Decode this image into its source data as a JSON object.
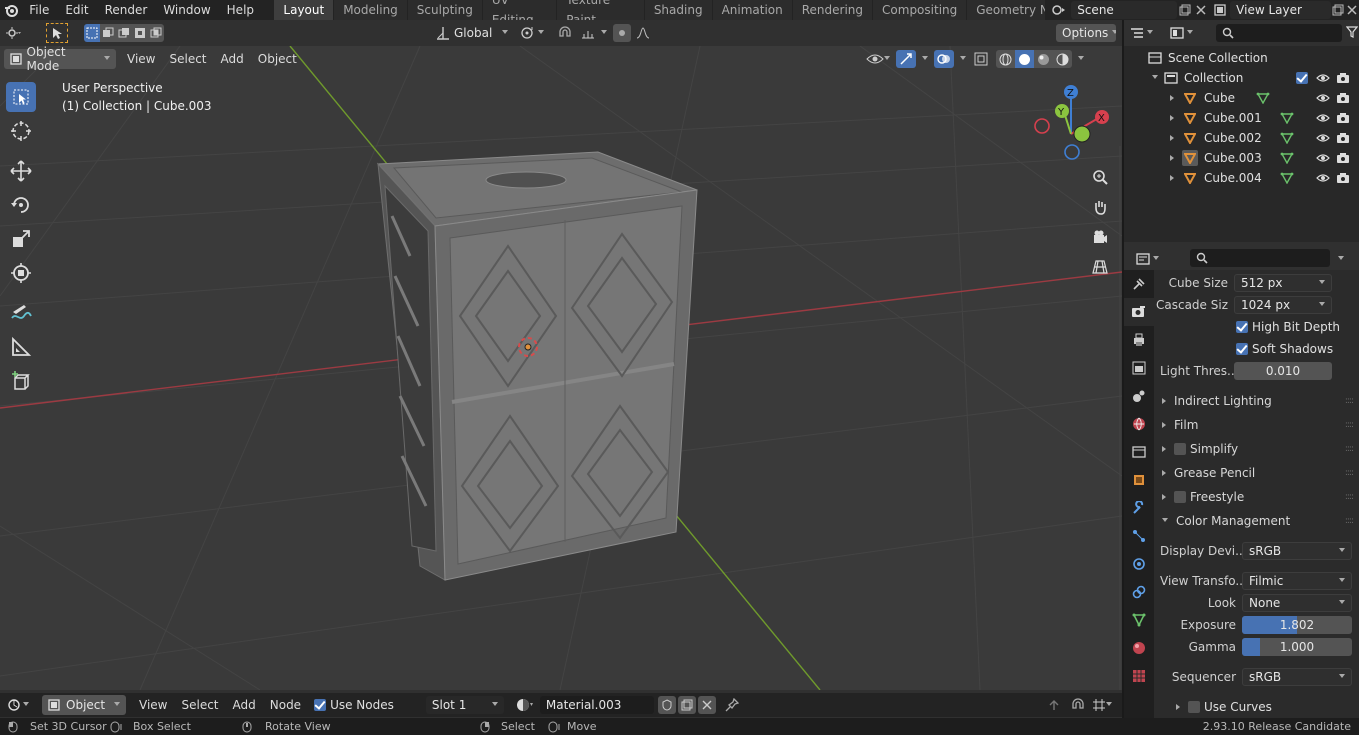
{
  "topbar": {
    "menus": [
      "File",
      "Edit",
      "Render",
      "Window",
      "Help"
    ],
    "workspaces": [
      "Layout",
      "Modeling",
      "Sculpting",
      "UV Editing",
      "Texture Paint",
      "Shading",
      "Animation",
      "Rendering",
      "Compositing",
      "Geometry Nod"
    ],
    "active_workspace": "Layout",
    "scene": "Scene",
    "view_layer": "View Layer"
  },
  "viewport_header": {
    "mode": "Object Mode",
    "menus": [
      "View",
      "Select",
      "Add",
      "Object"
    ],
    "transform_orientation": "Global",
    "options": "Options"
  },
  "viewport": {
    "perspective": "User Perspective",
    "selection_info": "(1) Collection | Cube.003",
    "gizmo_axes": [
      "Z",
      "Y",
      "X"
    ]
  },
  "outliner": {
    "root": "Scene Collection",
    "collection": "Collection",
    "objects": [
      "Cube",
      "Cube.001",
      "Cube.002",
      "Cube.003",
      "Cube.004"
    ],
    "selected": "Cube.003"
  },
  "properties": {
    "cube_size_label": "Cube Size",
    "cube_size": "512 px",
    "cascade_size_label": "Cascade Siz",
    "cascade_size": "1024 px",
    "high_bit_depth": "High Bit Depth",
    "soft_shadows": "Soft Shadows",
    "light_threshold_label": "Light Thres...",
    "light_threshold": "0.010",
    "panels": [
      "Indirect Lighting",
      "Film",
      "Simplify",
      "Grease Pencil",
      "Freestyle",
      "Color Management"
    ],
    "display_device_label": "Display Devi...",
    "display_device": "sRGB",
    "view_transform_label": "View Transfo...",
    "view_transform": "Filmic",
    "look_label": "Look",
    "look": "None",
    "exposure_label": "Exposure",
    "exposure": "1.802",
    "exposure_fill": 0.5,
    "gamma_label": "Gamma",
    "gamma": "1.000",
    "gamma_fill": 0.16,
    "sequencer_label": "Sequencer",
    "sequencer": "sRGB",
    "use_curves": "Use Curves"
  },
  "shader_header": {
    "type": "Object",
    "menus": [
      "View",
      "Select",
      "Add",
      "Node"
    ],
    "use_nodes": "Use Nodes",
    "slot": "Slot 1",
    "material": "Material.003"
  },
  "statusbar": {
    "set_cursor": "Set 3D Cursor",
    "box_select": "Box Select",
    "rotate_view": "Rotate View",
    "select": "Select",
    "move": "Move",
    "version": "2.93.10 Release Candidate"
  },
  "colors": {
    "accent": "#4772b3",
    "x_axis": "#d6404e",
    "y_axis": "#8bc43f",
    "z_axis": "#3f7fd4",
    "object_orange": "#e0913b",
    "mesh_green": "#6bc16b"
  }
}
